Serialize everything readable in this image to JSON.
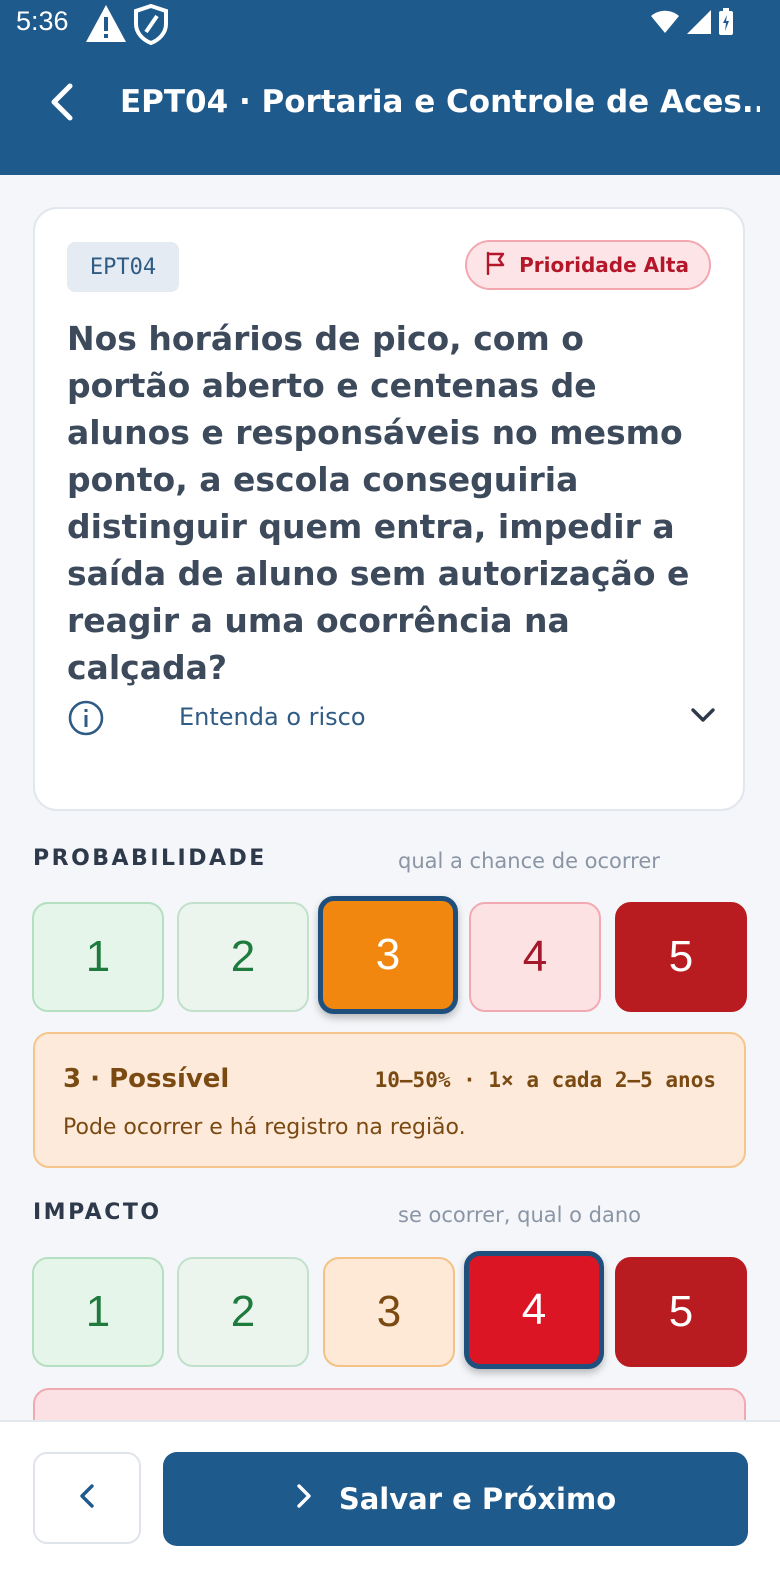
{
  "status_bar": {
    "time": "5:36",
    "icons": [
      "warning-icon",
      "shield-icon",
      "wifi-icon",
      "signal-icon",
      "battery-icon"
    ]
  },
  "app_bar": {
    "back_icon": "chevron-left-icon",
    "title": "EPT04 · Portaria e Controle de Aces..."
  },
  "question": {
    "code": "EPT04",
    "priority_label": "Prioridade Alta",
    "priority_icon": "flag-icon",
    "text": "Nos horários de pico, com o portão aberto e centenas de alunos e responsáveis no mesmo ponto, a escola conseguiria distinguir quem entra, impedir a saída de aluno sem autorização e reagir a uma ocorrência na calçada?",
    "risk_toggle": {
      "label": "Entenda o risco",
      "icon": "info-icon",
      "expand_icon": "chevron-down-icon"
    }
  },
  "probability": {
    "label": "PROBABILIDADE",
    "hint": "qual a chance de ocorrer",
    "options": [
      "1",
      "2",
      "3",
      "4",
      "5"
    ],
    "selected": 3,
    "detail": {
      "title": "3 · Possível",
      "range": "10–50% · 1× a cada 2–5 anos",
      "description": "Pode ocorrer e há registro na região."
    }
  },
  "impact": {
    "label": "IMPACTO",
    "hint": "se ocorrer, qual o dano",
    "options": [
      "1",
      "2",
      "3",
      "4",
      "5"
    ],
    "selected": 4
  },
  "footer": {
    "prev_icon": "chevron-left-icon",
    "next_label": "Salvar e Próximo",
    "next_icon": "chevron-right-icon"
  },
  "colors": {
    "primary": "#1f5a8c",
    "probability_selected": "#f2870f",
    "impact_selected": "#dc1525",
    "high_risk": "#b81c20",
    "priority_high": "#b4172a"
  }
}
